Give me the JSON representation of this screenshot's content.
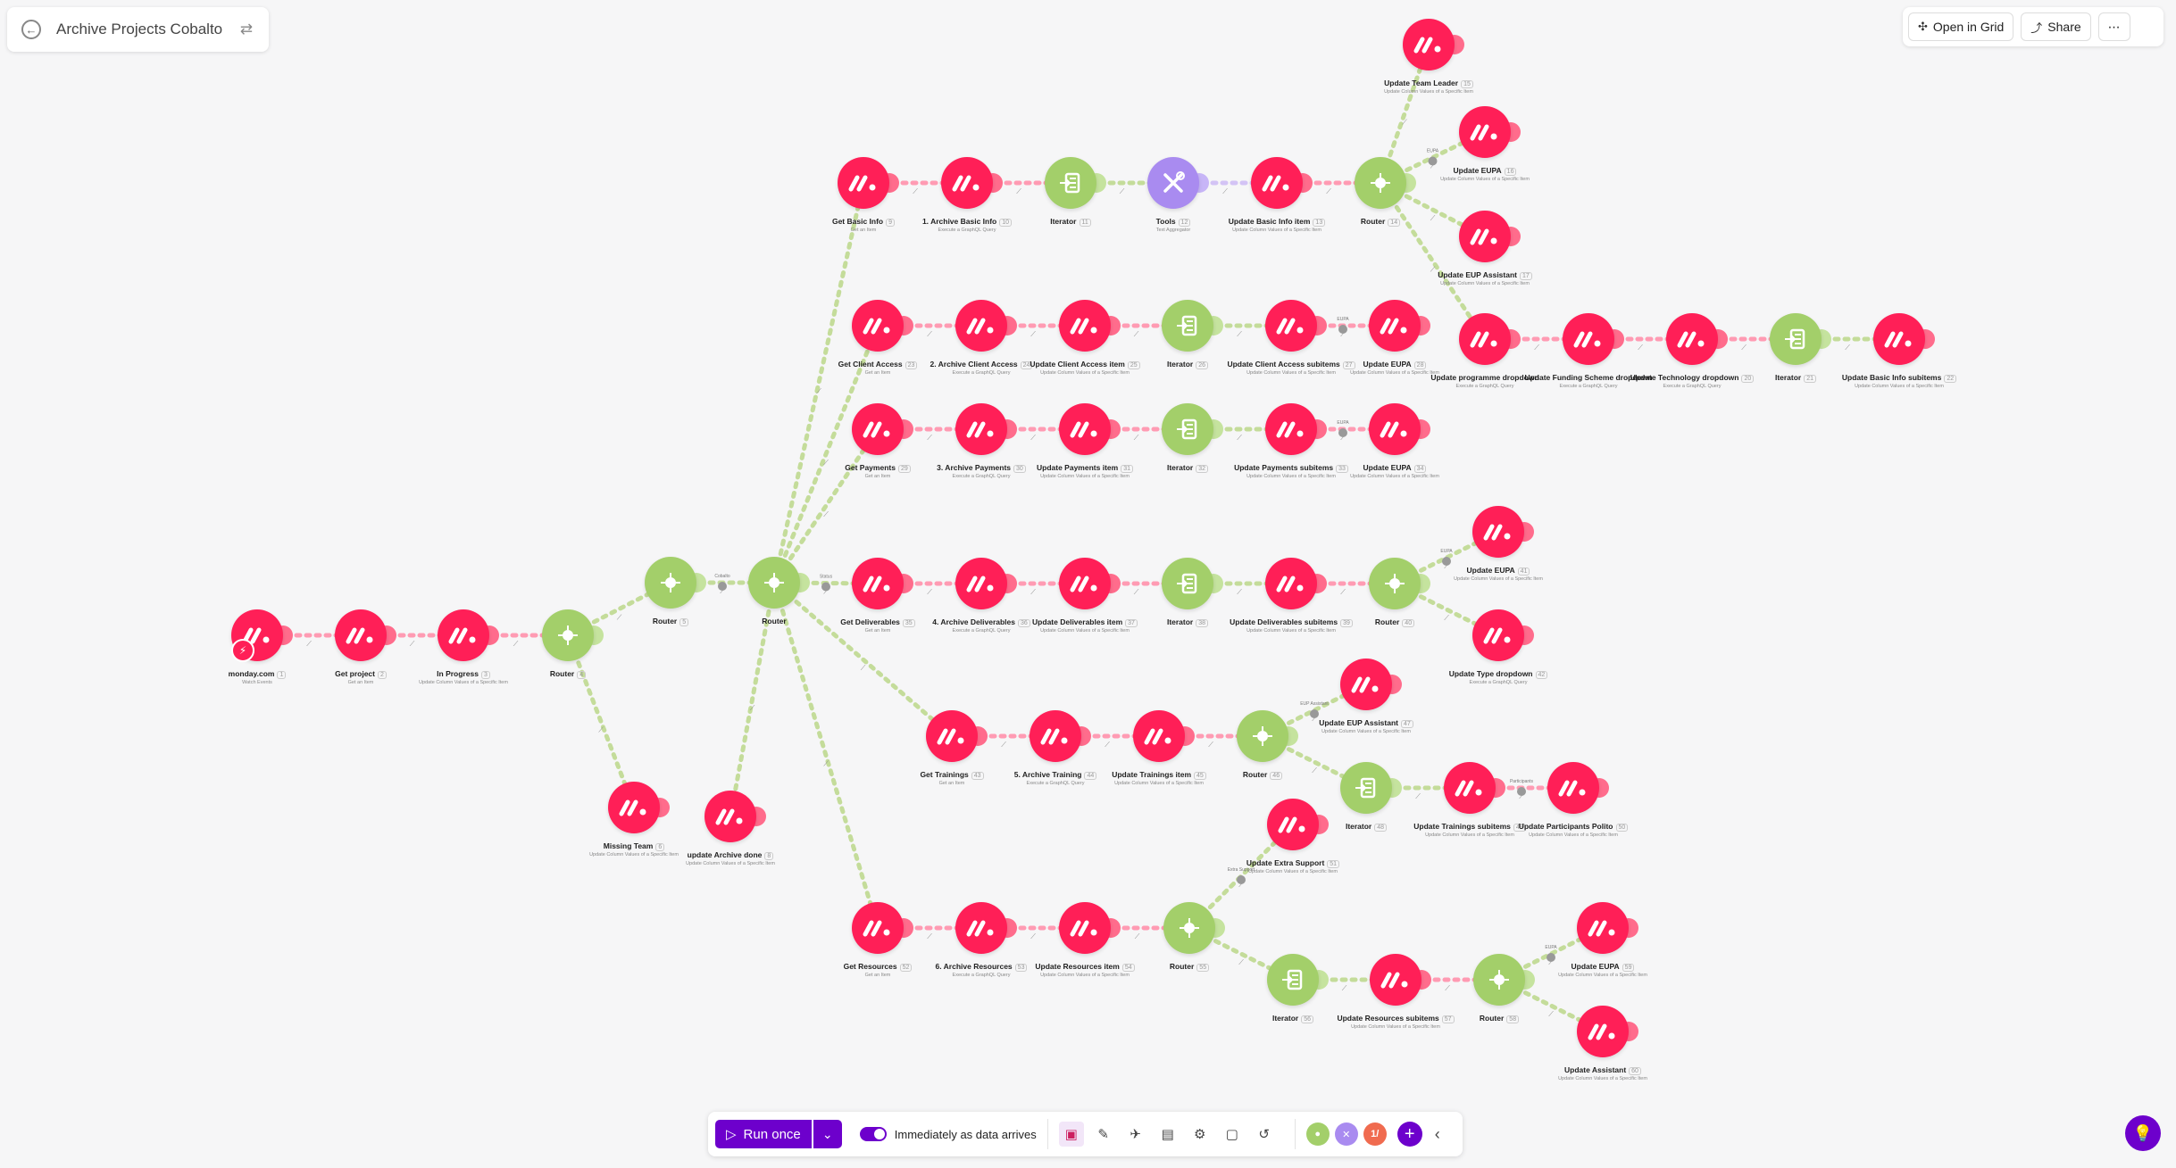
{
  "scenario": {
    "title": "Archive Projects Cobalto"
  },
  "header": {
    "open_grid_label": "Open in Grid",
    "share_label": "Share",
    "more_label": "⋯"
  },
  "toolbar": {
    "run_label": "Run once",
    "schedule_label": "Immediately as data arrives",
    "app_dot_label": "1/"
  },
  "colors": {
    "monday": "#ff1f57",
    "flow": "#a3cf6a",
    "tools": "#a98bf0",
    "accent": "#6d00cc"
  },
  "nodes": [
    {
      "id": "n1",
      "type": "monday",
      "label": "monday.com",
      "num": "1",
      "sub": "Watch Events",
      "trigger": true
    },
    {
      "id": "n2",
      "type": "monday",
      "label": "Get project",
      "num": "2",
      "sub": "Get an Item"
    },
    {
      "id": "n3",
      "type": "monday",
      "label": "In Progress",
      "num": "3",
      "sub": "Update Column Values of a Specific Item"
    },
    {
      "id": "n4",
      "type": "flow",
      "label": "Router",
      "num": "4",
      "sub": ""
    },
    {
      "id": "n5",
      "type": "flow",
      "label": "Router",
      "num": "5",
      "sub": ""
    },
    {
      "id": "n6",
      "type": "monday",
      "label": "Missing Team",
      "num": "6",
      "sub": "Update Column Values of a Specific Item"
    },
    {
      "id": "n7",
      "type": "flow",
      "label": "Router",
      "num": "",
      "sub": ""
    },
    {
      "id": "n8",
      "type": "monday",
      "label": "update Archive done",
      "num": "8",
      "sub": "Update Column Values of a Specific Item"
    },
    {
      "id": "n9",
      "type": "monday",
      "label": "Get Basic Info",
      "num": "9",
      "sub": "Get an Item"
    },
    {
      "id": "n10",
      "type": "monday",
      "label": "1. Archive Basic Info",
      "num": "10",
      "sub": "Execute a GraphQL Query"
    },
    {
      "id": "n11",
      "type": "flow",
      "label": "Iterator",
      "num": "11",
      "sub": ""
    },
    {
      "id": "n12",
      "type": "tools",
      "label": "Tools",
      "num": "12",
      "sub": "Text Aggregator"
    },
    {
      "id": "n13",
      "type": "monday",
      "label": "Update Basic Info item",
      "num": "13",
      "sub": "Update Column Values of a Specific Item"
    },
    {
      "id": "n14",
      "type": "flow",
      "label": "Router",
      "num": "14",
      "sub": ""
    },
    {
      "id": "n15",
      "type": "monday",
      "label": "Update Team Leader",
      "num": "15",
      "sub": "Update Column Values of a Specific Item"
    },
    {
      "id": "n16",
      "type": "monday",
      "label": "Update EUPA",
      "num": "16",
      "sub": "Update Column Values of a Specific Item"
    },
    {
      "id": "n17",
      "type": "monday",
      "label": "Update EUP Assistant",
      "num": "17",
      "sub": "Update Column Values of a Specific Item"
    },
    {
      "id": "n18",
      "type": "monday",
      "label": "Update programme dropdown",
      "num": "",
      "sub": "Execute a GraphQL Query"
    },
    {
      "id": "n19",
      "type": "monday",
      "label": "Update Funding Scheme dropdown",
      "num": "",
      "sub": "Execute a GraphQL Query"
    },
    {
      "id": "n20",
      "type": "monday",
      "label": "Update Technology dropdown",
      "num": "20",
      "sub": "Execute a GraphQL Query"
    },
    {
      "id": "n21",
      "type": "flow",
      "label": "Iterator",
      "num": "21",
      "sub": ""
    },
    {
      "id": "n22",
      "type": "monday",
      "label": "Update Basic Info subitems",
      "num": "22",
      "sub": "Update Column Values of a Specific Item"
    },
    {
      "id": "n23",
      "type": "monday",
      "label": "Get Client Access",
      "num": "23",
      "sub": "Get an Item"
    },
    {
      "id": "n24",
      "type": "monday",
      "label": "2. Archive Client Access",
      "num": "24",
      "sub": "Execute a GraphQL Query"
    },
    {
      "id": "n25",
      "type": "monday",
      "label": "Update Client Access item",
      "num": "25",
      "sub": "Update Column Values of a Specific Item"
    },
    {
      "id": "n26",
      "type": "flow",
      "label": "Iterator",
      "num": "26",
      "sub": ""
    },
    {
      "id": "n27",
      "type": "monday",
      "label": "Update Client Access subitems",
      "num": "27",
      "sub": "Update Column Values of a Specific Item"
    },
    {
      "id": "n28",
      "type": "monday",
      "label": "Update EUPA",
      "num": "28",
      "sub": "Update Column Values of a Specific Item"
    },
    {
      "id": "n29",
      "type": "monday",
      "label": "Get Payments",
      "num": "29",
      "sub": "Get an Item"
    },
    {
      "id": "n30",
      "type": "monday",
      "label": "3. Archive Payments",
      "num": "30",
      "sub": "Execute a GraphQL Query"
    },
    {
      "id": "n31",
      "type": "monday",
      "label": "Update Payments item",
      "num": "31",
      "sub": "Update Column Values of a Specific Item"
    },
    {
      "id": "n32",
      "type": "flow",
      "label": "Iterator",
      "num": "32",
      "sub": ""
    },
    {
      "id": "n33",
      "type": "monday",
      "label": "Update Payments subitems",
      "num": "33",
      "sub": "Update Column Values of a Specific Item"
    },
    {
      "id": "n34",
      "type": "monday",
      "label": "Update EUPA",
      "num": "34",
      "sub": "Update Column Values of a Specific Item"
    },
    {
      "id": "n35",
      "type": "monday",
      "label": "Get Deliverables",
      "num": "35",
      "sub": "Get an Item"
    },
    {
      "id": "n36",
      "type": "monday",
      "label": "4. Archive Deliverables",
      "num": "36",
      "sub": "Execute a GraphQL Query"
    },
    {
      "id": "n37",
      "type": "monday",
      "label": "Update Deliverables item",
      "num": "37",
      "sub": "Update Column Values of a Specific Item"
    },
    {
      "id": "n38",
      "type": "flow",
      "label": "Iterator",
      "num": "38",
      "sub": ""
    },
    {
      "id": "n39",
      "type": "monday",
      "label": "Update Deliverables subitems",
      "num": "39",
      "sub": "Update Column Values of a Specific Item"
    },
    {
      "id": "n40",
      "type": "flow",
      "label": "Router",
      "num": "40",
      "sub": ""
    },
    {
      "id": "n41",
      "type": "monday",
      "label": "Update EUPA",
      "num": "41",
      "sub": "Update Column Values of a Specific Item"
    },
    {
      "id": "n42",
      "type": "monday",
      "label": "Update Type dropdown",
      "num": "42",
      "sub": "Execute a GraphQL Query"
    },
    {
      "id": "n43",
      "type": "monday",
      "label": "Get Trainings",
      "num": "43",
      "sub": "Get an Item"
    },
    {
      "id": "n44",
      "type": "monday",
      "label": "5. Archive Training",
      "num": "44",
      "sub": "Execute a GraphQL Query"
    },
    {
      "id": "n45",
      "type": "monday",
      "label": "Update Trainings item",
      "num": "45",
      "sub": "Update Column Values of a Specific Item"
    },
    {
      "id": "n46",
      "type": "flow",
      "label": "Router",
      "num": "46",
      "sub": ""
    },
    {
      "id": "n47",
      "type": "monday",
      "label": "Update EUP Assistant",
      "num": "47",
      "sub": "Update Column Values of a Specific Item"
    },
    {
      "id": "n48",
      "type": "flow",
      "label": "Iterator",
      "num": "48",
      "sub": ""
    },
    {
      "id": "n49",
      "type": "monday",
      "label": "Update Trainings subitems",
      "num": "49",
      "sub": "Update Column Values of a Specific Item"
    },
    {
      "id": "n50",
      "type": "monday",
      "label": "Update Participants Polito",
      "num": "50",
      "sub": "Update Column Values of a Specific Item"
    },
    {
      "id": "n51",
      "type": "monday",
      "label": "Update Extra Support",
      "num": "51",
      "sub": "Update Column Values of a Specific Item"
    },
    {
      "id": "n52",
      "type": "monday",
      "label": "Get Resources",
      "num": "52",
      "sub": "Get an Item"
    },
    {
      "id": "n53",
      "type": "monday",
      "label": "6. Archive Resources",
      "num": "53",
      "sub": "Execute a GraphQL Query"
    },
    {
      "id": "n54",
      "type": "monday",
      "label": "Update Resources item",
      "num": "54",
      "sub": "Update Column Values of a Specific Item"
    },
    {
      "id": "n55",
      "type": "flow",
      "label": "Router",
      "num": "55",
      "sub": ""
    },
    {
      "id": "n56",
      "type": "flow",
      "label": "Iterator",
      "num": "56",
      "sub": ""
    },
    {
      "id": "n57",
      "type": "monday",
      "label": "Update Resources subitems",
      "num": "57",
      "sub": "Update Column Values of a Specific Item"
    },
    {
      "id": "n58",
      "type": "flow",
      "label": "Router",
      "num": "58",
      "sub": ""
    },
    {
      "id": "n59",
      "type": "monday",
      "label": "Update EUPA",
      "num": "59",
      "sub": "Update Column Values of a Specific Item"
    },
    {
      "id": "n60",
      "type": "monday",
      "label": "Update Assistant",
      "num": "60",
      "sub": "Update Column Values of a Specific Item"
    }
  ],
  "edge_labels": {
    "n5-n7": "Cobalto",
    "n7-n35": "Status",
    "n14-n16": "EUPA",
    "n27-n28": "EUPA",
    "n33-n34": "EUPA",
    "n40-n41": "EUPA",
    "n46-n47": "EUP Assistant",
    "n49-n50": "Participants",
    "n58-n59": "EUPA",
    "n55-n51": "Extra Support"
  }
}
